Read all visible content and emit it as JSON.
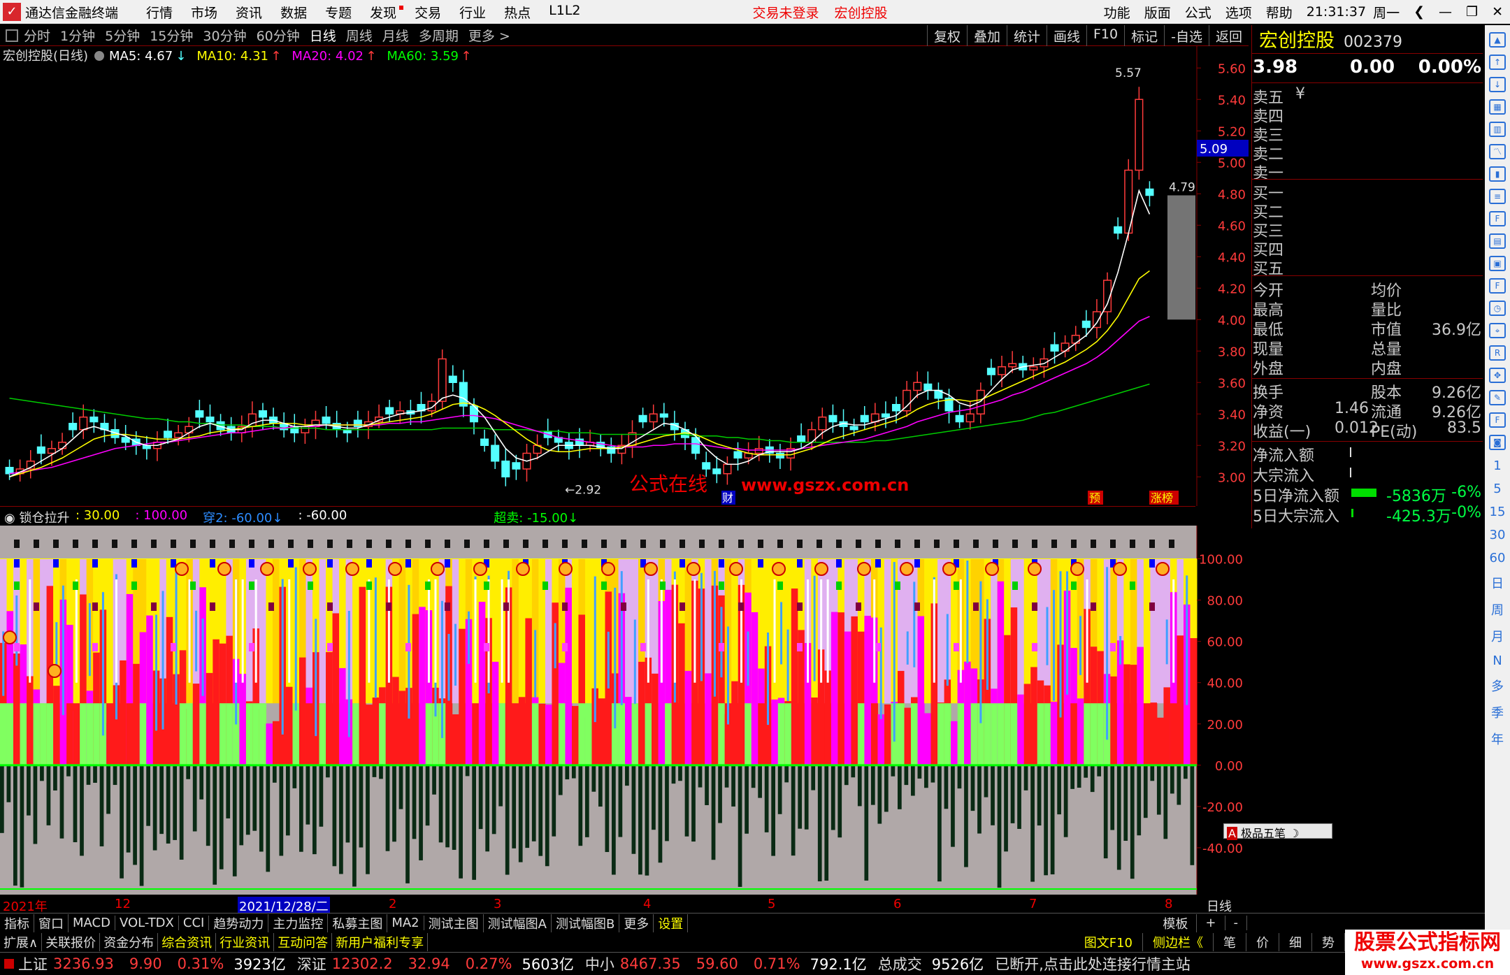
{
  "titlebar": {
    "app_title": "通达信金融终端",
    "menus": [
      "行情",
      "市场",
      "资讯",
      "数据",
      "专题",
      "发现",
      "交易",
      "行业",
      "热点",
      "L1L2"
    ],
    "status_login": "交易未登录",
    "stock_name": "宏创控股",
    "right_menus": [
      "功能",
      "版面",
      "公式",
      "选项",
      "帮助"
    ],
    "clock": "21:31:37",
    "weekday": "周一"
  },
  "periodbar": {
    "items": [
      "分时",
      "1分钟",
      "5分钟",
      "15分钟",
      "30分钟",
      "60分钟",
      "日线",
      "周线",
      "月线",
      "多周期",
      "更多 >"
    ],
    "active": "日线",
    "tools": [
      "复权",
      "叠加",
      "统计",
      "画线",
      "F10",
      "标记",
      "-自选",
      "返回"
    ]
  },
  "mainchart": {
    "stock_label": "宏创控股(日线)",
    "ma": [
      {
        "label": "MA5: 4.67",
        "arrow": "↓",
        "color": "#ffffff"
      },
      {
        "label": "MA10: 4.31",
        "arrow": "↑",
        "color": "#ffff00"
      },
      {
        "label": "MA20: 4.02",
        "arrow": "↑",
        "color": "#ff00ff"
      },
      {
        "label": "MA60: 3.59",
        "arrow": "↑",
        "color": "#00ff00"
      }
    ],
    "price_ticks": [
      "5.60",
      "5.40",
      "5.20",
      "5.00",
      "4.80",
      "4.60",
      "4.40",
      "4.20",
      "4.00",
      "3.80",
      "3.60",
      "3.40",
      "3.20",
      "3.00"
    ],
    "current_price_tag": "5.09",
    "high_label": "5.57",
    "low_label": "2.92",
    "last_label": "4.79",
    "watermark": "公式在线",
    "watermark_url": "www.gszx.com.cn",
    "badge_cai": "财",
    "badge_yu": "预",
    "badge_zhangbang": "涨榜"
  },
  "chart_data": {
    "type": "candlestick",
    "price_range": [
      2.85,
      5.65
    ],
    "low": 2.92,
    "high": 5.57,
    "close": [
      3.02,
      3.05,
      3.1,
      3.15,
      3.18,
      3.22,
      3.3,
      3.38,
      3.35,
      3.3,
      3.25,
      3.22,
      3.2,
      3.18,
      3.22,
      3.25,
      3.28,
      3.32,
      3.38,
      3.35,
      3.3,
      3.28,
      3.32,
      3.4,
      3.38,
      3.34,
      3.3,
      3.28,
      3.32,
      3.36,
      3.34,
      3.3,
      3.28,
      3.32,
      3.35,
      3.38,
      3.4,
      3.42,
      3.4,
      3.42,
      3.48,
      3.75,
      3.6,
      3.45,
      3.35,
      3.2,
      3.1,
      3.0,
      3.05,
      3.15,
      3.2,
      3.25,
      3.22,
      3.18,
      3.2,
      3.22,
      3.18,
      3.15,
      3.2,
      3.28,
      3.35,
      3.4,
      3.38,
      3.3,
      3.25,
      3.15,
      3.05,
      3.02,
      3.08,
      3.12,
      3.15,
      3.18,
      3.15,
      3.12,
      3.18,
      3.22,
      3.3,
      3.38,
      3.35,
      3.32,
      3.3,
      3.35,
      3.4,
      3.38,
      3.42,
      3.55,
      3.6,
      3.55,
      3.5,
      3.42,
      3.35,
      3.4,
      3.55,
      3.65,
      3.7,
      3.72,
      3.68,
      3.7,
      3.75,
      3.8,
      3.85,
      3.9,
      3.95,
      4.05,
      4.25,
      4.55,
      4.95,
      5.4,
      4.79
    ],
    "ma5": [
      3.0,
      3.03,
      3.06,
      3.1,
      3.14,
      3.18,
      3.24,
      3.3,
      3.32,
      3.3,
      3.28,
      3.26,
      3.22,
      3.2,
      3.2,
      3.22,
      3.24,
      3.28,
      3.32,
      3.34,
      3.32,
      3.3,
      3.3,
      3.34,
      3.36,
      3.36,
      3.34,
      3.32,
      3.32,
      3.33,
      3.33,
      3.32,
      3.31,
      3.31,
      3.33,
      3.36,
      3.38,
      3.4,
      3.41,
      3.42,
      3.44,
      3.5,
      3.52,
      3.5,
      3.45,
      3.38,
      3.28,
      3.18,
      3.12,
      3.1,
      3.12,
      3.16,
      3.2,
      3.2,
      3.2,
      3.2,
      3.19,
      3.18,
      3.18,
      3.22,
      3.26,
      3.3,
      3.34,
      3.33,
      3.3,
      3.26,
      3.18,
      3.12,
      3.08,
      3.08,
      3.1,
      3.14,
      3.16,
      3.16,
      3.16,
      3.18,
      3.22,
      3.28,
      3.32,
      3.34,
      3.33,
      3.33,
      3.35,
      3.37,
      3.39,
      3.45,
      3.52,
      3.55,
      3.55,
      3.52,
      3.47,
      3.45,
      3.48,
      3.55,
      3.62,
      3.68,
      3.7,
      3.71,
      3.72,
      3.76,
      3.8,
      3.85,
      3.9,
      3.98,
      4.1,
      4.3,
      4.55,
      4.82,
      4.67
    ],
    "ma10": [
      3.0,
      3.02,
      3.04,
      3.06,
      3.09,
      3.12,
      3.16,
      3.2,
      3.24,
      3.26,
      3.27,
      3.27,
      3.26,
      3.25,
      3.24,
      3.24,
      3.24,
      3.25,
      3.26,
      3.28,
      3.29,
      3.3,
      3.31,
      3.32,
      3.33,
      3.34,
      3.34,
      3.34,
      3.33,
      3.33,
      3.33,
      3.33,
      3.33,
      3.33,
      3.33,
      3.34,
      3.35,
      3.36,
      3.37,
      3.38,
      3.4,
      3.43,
      3.46,
      3.47,
      3.46,
      3.43,
      3.39,
      3.34,
      3.29,
      3.24,
      3.2,
      3.17,
      3.16,
      3.16,
      3.17,
      3.18,
      3.18,
      3.18,
      3.19,
      3.2,
      3.22,
      3.24,
      3.26,
      3.27,
      3.28,
      3.27,
      3.24,
      3.21,
      3.19,
      3.17,
      3.15,
      3.14,
      3.14,
      3.14,
      3.14,
      3.16,
      3.18,
      3.21,
      3.24,
      3.26,
      3.28,
      3.3,
      3.32,
      3.34,
      3.36,
      3.39,
      3.43,
      3.46,
      3.48,
      3.49,
      3.49,
      3.48,
      3.49,
      3.52,
      3.55,
      3.58,
      3.61,
      3.64,
      3.67,
      3.7,
      3.73,
      3.77,
      3.81,
      3.86,
      3.93,
      4.02,
      4.14,
      4.26,
      4.31
    ],
    "ma20": [
      3.02,
      3.03,
      3.04,
      3.05,
      3.06,
      3.08,
      3.1,
      3.12,
      3.14,
      3.16,
      3.18,
      3.19,
      3.2,
      3.21,
      3.22,
      3.22,
      3.23,
      3.24,
      3.25,
      3.26,
      3.27,
      3.28,
      3.28,
      3.29,
      3.3,
      3.31,
      3.31,
      3.32,
      3.32,
      3.32,
      3.33,
      3.33,
      3.33,
      3.33,
      3.33,
      3.33,
      3.34,
      3.34,
      3.35,
      3.35,
      3.36,
      3.37,
      3.38,
      3.39,
      3.39,
      3.38,
      3.37,
      3.35,
      3.33,
      3.31,
      3.29,
      3.27,
      3.25,
      3.24,
      3.23,
      3.22,
      3.21,
      3.2,
      3.19,
      3.19,
      3.19,
      3.2,
      3.2,
      3.21,
      3.21,
      3.21,
      3.2,
      3.19,
      3.18,
      3.18,
      3.17,
      3.17,
      3.17,
      3.17,
      3.17,
      3.18,
      3.19,
      3.2,
      3.21,
      3.22,
      3.23,
      3.24,
      3.26,
      3.28,
      3.3,
      3.32,
      3.35,
      3.37,
      3.39,
      3.41,
      3.42,
      3.43,
      3.45,
      3.47,
      3.49,
      3.52,
      3.54,
      3.57,
      3.6,
      3.63,
      3.66,
      3.69,
      3.72,
      3.76,
      3.81,
      3.87,
      3.93,
      3.99,
      4.02
    ],
    "ma60": [
      3.5,
      3.49,
      3.48,
      3.47,
      3.46,
      3.45,
      3.44,
      3.43,
      3.42,
      3.41,
      3.4,
      3.39,
      3.38,
      3.37,
      3.37,
      3.36,
      3.35,
      3.35,
      3.34,
      3.34,
      3.33,
      3.33,
      3.33,
      3.32,
      3.32,
      3.32,
      3.31,
      3.31,
      3.31,
      3.31,
      3.3,
      3.3,
      3.3,
      3.3,
      3.3,
      3.3,
      3.3,
      3.3,
      3.3,
      3.3,
      3.3,
      3.31,
      3.31,
      3.31,
      3.31,
      3.31,
      3.3,
      3.3,
      3.3,
      3.3,
      3.29,
      3.29,
      3.29,
      3.28,
      3.28,
      3.28,
      3.27,
      3.27,
      3.27,
      3.27,
      3.27,
      3.27,
      3.27,
      3.27,
      3.27,
      3.26,
      3.26,
      3.26,
      3.25,
      3.25,
      3.24,
      3.24,
      3.23,
      3.23,
      3.22,
      3.22,
      3.22,
      3.22,
      3.22,
      3.22,
      3.22,
      3.22,
      3.23,
      3.23,
      3.24,
      3.25,
      3.26,
      3.27,
      3.28,
      3.29,
      3.3,
      3.31,
      3.32,
      3.33,
      3.34,
      3.35,
      3.36,
      3.38,
      3.4,
      3.41,
      3.43,
      3.45,
      3.47,
      3.49,
      3.51,
      3.53,
      3.55,
      3.57,
      3.59
    ]
  },
  "indicator": {
    "name": "锁仓拉升",
    "params": [
      {
        "text": ": 30.00",
        "color": "#ffff00"
      },
      {
        "text": ": 100.00",
        "color": "#ff00ff"
      },
      {
        "text": "穿2: -60.00↓",
        "color": "#2d8cff"
      },
      {
        "text": ": -60.00",
        "color": "#ffffff"
      },
      {
        "text": "超卖: -15.00↓",
        "color": "#00ff00"
      }
    ],
    "ticks": [
      "100.00",
      "80.00",
      "60.00",
      "40.00",
      "20.00",
      "0.00",
      "-20.00",
      "-40.00"
    ],
    "tooltip": "极品五笔"
  },
  "dateaxis": {
    "labels": [
      "2021年",
      "12",
      "2021/12/28/二",
      "2",
      "3",
      "4",
      "5",
      "6",
      "7",
      "8"
    ],
    "period": "日线"
  },
  "quote_panel": {
    "name": "宏创控股",
    "code": "002379",
    "price": "3.98",
    "change": "0.00",
    "pct": "0.00%",
    "sell": [
      "卖五",
      "卖四",
      "卖三",
      "卖二",
      "卖一"
    ],
    "currency": "¥",
    "buy": [
      "买一",
      "买二",
      "买三",
      "买四",
      "买五"
    ],
    "rows1": [
      {
        "l": "今开",
        "v": "",
        "l2": "均价",
        "v2": ""
      },
      {
        "l": "最高",
        "v": "",
        "l2": "量比",
        "v2": ""
      },
      {
        "l": "最低",
        "v": "",
        "l2": "市值",
        "v2": "36.9亿"
      },
      {
        "l": "现量",
        "v": "",
        "l2": "总量",
        "v2": ""
      },
      {
        "l": "外盘",
        "v": "",
        "l2": "内盘",
        "v2": ""
      }
    ],
    "rows2": [
      {
        "l": "换手",
        "v": "",
        "l2": "股本",
        "v2": "9.26亿"
      },
      {
        "l": "净资",
        "v": "1.46",
        "l2": "流通",
        "v2": "9.26亿"
      },
      {
        "l": "收益(一)",
        "v": "0.012",
        "l2": "PE(动)",
        "v2": "83.5"
      }
    ],
    "flows": [
      {
        "l": "净流入额",
        "v": "",
        "p": ""
      },
      {
        "l": "大宗流入",
        "v": "",
        "p": ""
      },
      {
        "l": "5日净流入额",
        "v": "-5836万",
        "p": "-6%"
      },
      {
        "l": "5日大宗流入",
        "v": "-425.3万",
        "p": "-0%"
      }
    ]
  },
  "right_icons": {
    "letters": [
      "1",
      "5",
      "15",
      "30",
      "60",
      "日",
      "周",
      "月",
      "N",
      "多",
      "季",
      "年"
    ]
  },
  "tabbar1": {
    "items": [
      "指标",
      "窗口",
      "MACD",
      "VOL-TDX",
      "CCI",
      "趋势动力",
      "主力监控",
      "私募主图",
      "MA2",
      "测试主图",
      "测试幅图A",
      "测试幅图B",
      "更多",
      "设置"
    ],
    "active": "设置",
    "right": [
      "模板",
      "+",
      "-"
    ]
  },
  "tabbar2": {
    "items": [
      "扩展∧",
      "关联报价",
      "资金分布",
      "综合资讯",
      "行业资讯",
      "互动问答",
      "新用户福利专享"
    ],
    "right": [
      "图文F10",
      "侧边栏《",
      "笔",
      "价",
      "细",
      "势"
    ]
  },
  "statusbar": {
    "indices": [
      {
        "name": "上证",
        "val": "3236.93",
        "chg": "9.90",
        "pct": "0.31%",
        "amt": "3923亿"
      },
      {
        "name": "深证",
        "val": "12302.2",
        "chg": "32.94",
        "pct": "0.27%",
        "amt": "5603亿"
      },
      {
        "name": "中小",
        "val": "8467.35",
        "chg": "59.60",
        "pct": "0.71%",
        "amt": "792.1亿"
      }
    ],
    "total_label": "总成交",
    "total_val": "9526亿",
    "msg": "已断开,点击此处连接行情主站"
  },
  "watermark_corner": {
    "line1": "股票公式指标网",
    "line2": "www.gszx.com.cn"
  }
}
